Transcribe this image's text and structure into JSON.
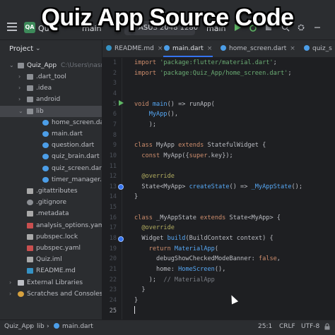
{
  "overlay_title": "Quiz App  Source Code",
  "titlebar": {
    "project_badge": "QA",
    "project_name": "Qui",
    "branch": "main",
    "device": "ASUS 2048 1280",
    "run_config": "main"
  },
  "project_panel": {
    "header": "Project",
    "root": {
      "name": "Quiz_App",
      "path": "C:\\Users\\nasru"
    },
    "items": [
      {
        "label": ".dart_tool",
        "type": "folder",
        "indent": 1,
        "arrow": "›"
      },
      {
        "label": ".idea",
        "type": "folder",
        "indent": 1,
        "arrow": "›"
      },
      {
        "label": "android",
        "type": "folder",
        "indent": 1,
        "arrow": "›"
      },
      {
        "label": "lib",
        "type": "folder",
        "indent": 1,
        "arrow": "⌄",
        "selected": true
      },
      {
        "label": "home_screen.dart",
        "type": "dart",
        "indent": 2
      },
      {
        "label": "main.dart",
        "type": "dart",
        "indent": 2
      },
      {
        "label": "question.dart",
        "type": "dart",
        "indent": 2
      },
      {
        "label": "quiz_brain.dart",
        "type": "dart",
        "indent": 2
      },
      {
        "label": "quiz_screen.dart",
        "type": "dart",
        "indent": 2
      },
      {
        "label": "timer_manager.dart",
        "type": "dart",
        "indent": 2
      },
      {
        "label": ".gitattributes",
        "type": "file",
        "indent": 1
      },
      {
        "label": ".gitignore",
        "type": "gear",
        "indent": 1
      },
      {
        "label": ".metadata",
        "type": "file",
        "indent": 1
      },
      {
        "label": "analysis_options.yaml",
        "type": "yaml",
        "indent": 1
      },
      {
        "label": "pubspec.lock",
        "type": "lock",
        "indent": 1
      },
      {
        "label": "pubspec.yaml",
        "type": "yaml",
        "indent": 1
      },
      {
        "label": "Quiz.iml",
        "type": "xml",
        "indent": 1
      },
      {
        "label": "README.md",
        "type": "md",
        "indent": 1
      },
      {
        "label": "External Libraries",
        "type": "lib",
        "indent": 0,
        "arrow": "›"
      },
      {
        "label": "Scratches and Consoles",
        "type": "scratch",
        "indent": 0,
        "arrow": "›"
      }
    ]
  },
  "tabs": [
    {
      "label": "README.md",
      "icon": "md-icon"
    },
    {
      "label": "main.dart",
      "icon": "dart-icon",
      "active": true
    },
    {
      "label": "home_screen.dart",
      "icon": "dart-icon"
    },
    {
      "label": "quiz_s",
      "icon": "dart-icon"
    }
  ],
  "code_lines": [
    {
      "n": "1",
      "tokens": [
        [
          "k",
          "import "
        ],
        [
          "s",
          "'package:flutter/material.dart'"
        ],
        [
          "t",
          ";"
        ]
      ]
    },
    {
      "n": "2",
      "tokens": [
        [
          "k",
          "import "
        ],
        [
          "s",
          "'package:Quiz_App/home_screen.dart'"
        ],
        [
          "t",
          ";"
        ]
      ]
    },
    {
      "n": "3",
      "tokens": []
    },
    {
      "n": "4",
      "tokens": []
    },
    {
      "n": "5",
      "tokens": [
        [
          "k",
          "void "
        ],
        [
          "f",
          "main"
        ],
        [
          "t",
          "() => runApp("
        ]
      ]
    },
    {
      "n": "6",
      "tokens": [
        [
          "t",
          "    "
        ],
        [
          "f",
          "MyApp"
        ],
        [
          "t",
          "(),"
        ]
      ]
    },
    {
      "n": "7",
      "tokens": [
        [
          "t",
          "    );"
        ]
      ]
    },
    {
      "n": "8",
      "tokens": []
    },
    {
      "n": "9",
      "tokens": [
        [
          "k",
          "class "
        ],
        [
          "t",
          "MyApp "
        ],
        [
          "k",
          "extends "
        ],
        [
          "t",
          "StatefulWidget {"
        ]
      ]
    },
    {
      "n": "10",
      "tokens": [
        [
          "t",
          "  "
        ],
        [
          "k",
          "const "
        ],
        [
          "t",
          "MyApp({"
        ],
        [
          "k",
          "super"
        ],
        [
          "t",
          ".key});"
        ]
      ]
    },
    {
      "n": "11",
      "tokens": []
    },
    {
      "n": "12",
      "tokens": [
        [
          "a",
          "  @override"
        ]
      ]
    },
    {
      "n": "13",
      "tokens": [
        [
          "t",
          "  State<MyApp> "
        ],
        [
          "f",
          "createState"
        ],
        [
          "t",
          "() => "
        ],
        [
          "f",
          "_MyAppState"
        ],
        [
          "t",
          "();"
        ]
      ]
    },
    {
      "n": "14",
      "tokens": [
        [
          "t",
          "}"
        ]
      ]
    },
    {
      "n": "15",
      "tokens": []
    },
    {
      "n": "16",
      "tokens": [
        [
          "k",
          "class "
        ],
        [
          "t",
          "_MyAppState "
        ],
        [
          "k",
          "extends "
        ],
        [
          "t",
          "State<MyApp> {"
        ]
      ]
    },
    {
      "n": "17",
      "tokens": [
        [
          "a",
          "  @override"
        ]
      ]
    },
    {
      "n": "18",
      "tokens": [
        [
          "t",
          "  Widget "
        ],
        [
          "f",
          "build"
        ],
        [
          "t",
          "(BuildContext context) {"
        ]
      ]
    },
    {
      "n": "19",
      "tokens": [
        [
          "t",
          "    "
        ],
        [
          "k",
          "return "
        ],
        [
          "f",
          "MaterialApp"
        ],
        [
          "t",
          "("
        ]
      ]
    },
    {
      "n": "20",
      "tokens": [
        [
          "t",
          "      debugShowCheckedModeBanner: "
        ],
        [
          "k",
          "false"
        ],
        [
          "t",
          ","
        ]
      ]
    },
    {
      "n": "21",
      "tokens": [
        [
          "t",
          "      home: "
        ],
        [
          "f",
          "HomeScreen"
        ],
        [
          "t",
          "(),"
        ]
      ]
    },
    {
      "n": "22",
      "tokens": [
        [
          "t",
          "    );  "
        ],
        [
          "c",
          "// MaterialApp"
        ]
      ]
    },
    {
      "n": "23",
      "tokens": [
        [
          "t",
          "  }"
        ]
      ]
    },
    {
      "n": "24",
      "tokens": [
        [
          "t",
          "}"
        ]
      ]
    },
    {
      "n": "25",
      "tokens": []
    }
  ],
  "statusbar": {
    "path": [
      "Quiz_App",
      "lib",
      "main.dart"
    ],
    "position": "25:1",
    "line_sep": "CRLF",
    "encoding": "UTF-8"
  }
}
